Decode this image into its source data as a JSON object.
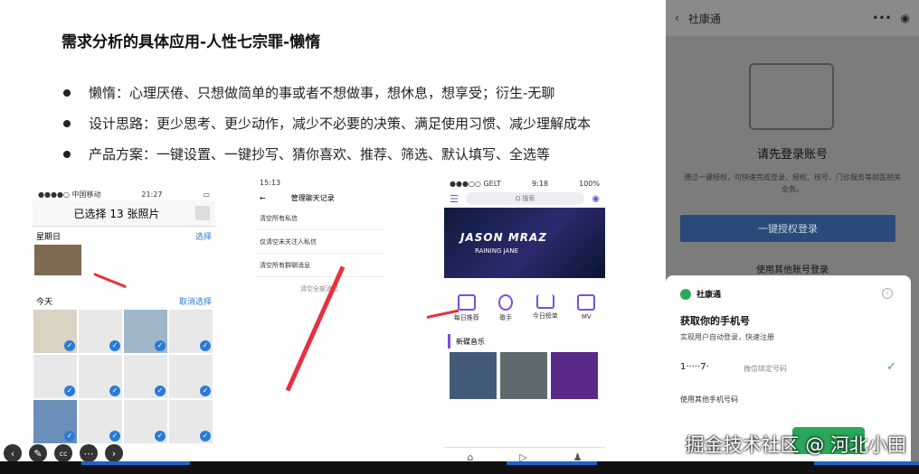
{
  "slide": {
    "title": "需求分析的具体应用-人性七宗罪-懒惰",
    "bullets": [
      "懒惰：心理厌倦、只想做简单的事或者不想做事，想休息，想享受；衍生-无聊",
      "设计思路：更少思考、更少动作，减少不必要的决策、满足使用习惯、减少理解成本",
      "产品方案：一键设置、一键抄写、猜你喜欢、推荐、筛选、默认填写、全选等"
    ]
  },
  "shot1": {
    "carrier": "●●●●○ 中国移动",
    "time": "21:27",
    "title": "已选择 13 张照片",
    "date_label": "星期日",
    "date_action": "选择",
    "today_label": "今天",
    "today_action": "取消选择"
  },
  "shot2": {
    "time": "15:13",
    "title": "管理聊天记录",
    "items": [
      "清空所有私信",
      "仅清空未关注人私信",
      "清空所有群聊消息"
    ],
    "clear_label": "清空全部消息"
  },
  "shot3": {
    "status_carrier": "●●●○○ GELT",
    "status_time": "9:18",
    "status_batt": "100%",
    "search_placeholder": "Q 搜索",
    "banner_title": "JASON MRAZ",
    "banner_sub": "RAINING JANE",
    "tabs": [
      "每日推荐",
      "歌手",
      "今日榜单",
      "MV"
    ],
    "section": "新碟音乐"
  },
  "phone": {
    "back": "社康通",
    "login_prompt": "请先登录账号",
    "login_desc": "通过一键授权，可快速完成登录、授权、核号，门诊服务等就医相关业务。",
    "auth_button": "一键授权登录",
    "other_login": "使用其他账号登录"
  },
  "sheet": {
    "app_name": "社康通",
    "heading": "获取你的手机号",
    "subtitle": "实现用户自动登录，快速注册",
    "phone_number": "1·····7·",
    "bind_label": "微信绑定号码",
    "use_other": "使用其他手机号码"
  },
  "watermark": "掘金技术社区 @ 河北小田",
  "colors": {
    "accent_red": "#e6323c",
    "wechat_green": "#2aa85a",
    "player_blue": "#1c66c8"
  }
}
